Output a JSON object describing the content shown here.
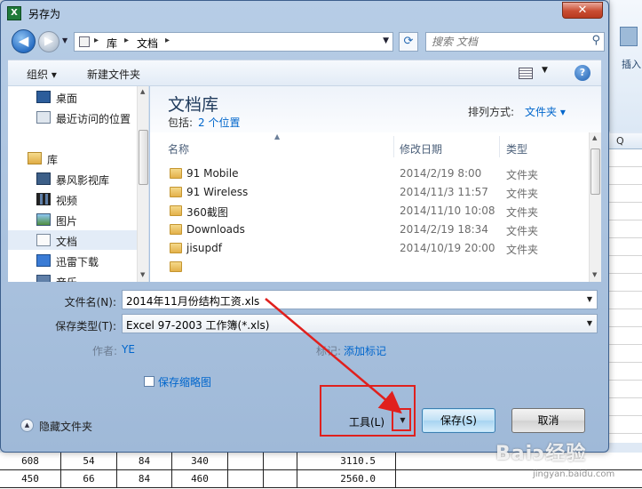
{
  "dialog": {
    "title": "另存为",
    "close_label": "✕"
  },
  "nav": {
    "breadcrumb": [
      "库",
      "文档"
    ],
    "search_placeholder": "搜索 文档"
  },
  "toolbar": {
    "organize": "组织 ▾",
    "new_folder": "新建文件夹"
  },
  "sidebar": {
    "items": [
      {
        "label": "桌面",
        "icon": "desktop-icon"
      },
      {
        "label": "最近访问的位置",
        "icon": "recent-places-icon"
      },
      {
        "label": "库",
        "icon": "library-icon"
      },
      {
        "label": "暴风影视库",
        "icon": "video-library-icon"
      },
      {
        "label": "视频",
        "icon": "videos-icon"
      },
      {
        "label": "图片",
        "icon": "pictures-icon"
      },
      {
        "label": "文档",
        "icon": "documents-icon"
      },
      {
        "label": "迅雷下载",
        "icon": "thunder-download-icon"
      },
      {
        "label": "音乐",
        "icon": "music-icon"
      }
    ]
  },
  "library": {
    "title": "文档库",
    "includes_label": "包括:",
    "includes_link": "2 个位置",
    "sort_label": "排列方式:",
    "sort_value": "文件夹 ▾"
  },
  "columns": [
    "名称",
    "修改日期",
    "类型"
  ],
  "files": [
    {
      "name": "91 Mobile",
      "date": "2014/2/19 8:00",
      "type": "文件夹"
    },
    {
      "name": "91 Wireless",
      "date": "2014/11/3 11:57",
      "type": "文件夹"
    },
    {
      "name": "360截图",
      "date": "2014/11/10 10:08",
      "type": "文件夹"
    },
    {
      "name": "Downloads",
      "date": "2014/2/19 18:34",
      "type": "文件夹"
    },
    {
      "name": "jisupdf",
      "date": "2014/10/19 20:00",
      "type": "文件夹"
    }
  ],
  "form": {
    "filename_label": "文件名(N):",
    "filename_value": "2014年11月份结构工资.xls",
    "filetype_label": "保存类型(T):",
    "filetype_value": "Excel 97-2003 工作簿(*.xls)",
    "author_label": "作者:",
    "author_value": "YE",
    "tags_label": "标记:",
    "tags_value": "添加标记",
    "thumbnail_label": "保存缩略图"
  },
  "footer": {
    "hide_folders": "隐藏文件夹",
    "tools": "工具(L)",
    "save": "保存(S)",
    "cancel": "取消"
  },
  "excel": {
    "ribbon_insert": "插入",
    "col_header": "Q",
    "rows": [
      [
        "608",
        "54",
        "84",
        "340",
        "3110.5"
      ],
      [
        "450",
        "66",
        "84",
        "460",
        "2560.0"
      ]
    ]
  },
  "watermark": {
    "brand": "Baiↄ经验",
    "sub": "jingyan.baidu.com"
  },
  "colors": {
    "annotation": "#e0201d",
    "link": "#0066cc",
    "frame": "#b7cde6"
  }
}
